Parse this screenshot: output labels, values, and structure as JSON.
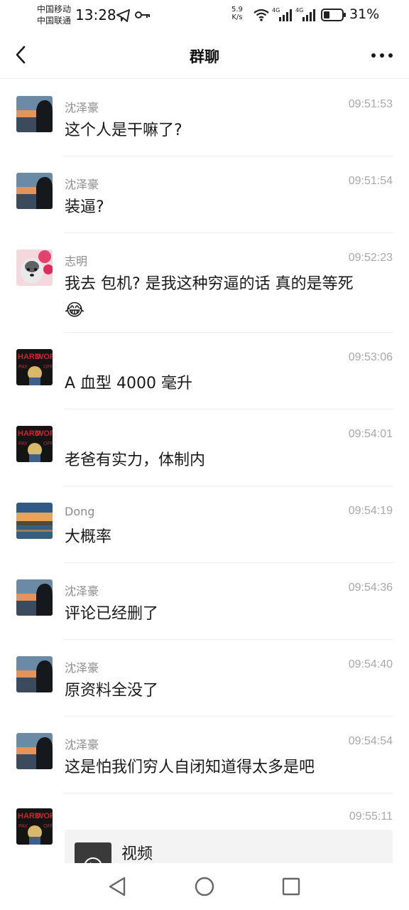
{
  "status_bar": {
    "carrier_1": "中国移动",
    "carrier_2": "中国联通",
    "time": "13:28",
    "speed_value": "5.9",
    "speed_unit": "K/s",
    "net_1": "4G",
    "net_2": "4G",
    "battery_percent": "31%",
    "icons": [
      "telegram-icon",
      "key-icon",
      "wifi-icon",
      "signal-icon",
      "battery-icon"
    ]
  },
  "header": {
    "title": "群聊",
    "back_icon": "chevron-left-icon",
    "more_icon": "more-dots-icon"
  },
  "messages": [
    {
      "sender": "沈泽豪",
      "time": "09:51:53",
      "text": "这个人是干嘛了?",
      "avatar": "silhouette-sunset"
    },
    {
      "sender": "沈泽豪",
      "time": "09:51:54",
      "text": "装逼?",
      "avatar": "silhouette-sunset"
    },
    {
      "sender": "志明",
      "time": "09:52:23",
      "text": "我去 包机? 是我这种穷逼的话 真的是等死",
      "emoji": "😂",
      "avatar": "husky-flowers"
    },
    {
      "sender": "",
      "time": "09:53:06",
      "text": "A 血型 4000 毫升",
      "avatar": "hardwork-poster"
    },
    {
      "sender": "",
      "time": "09:54:01",
      "text": "老爸有实力，体制内",
      "avatar": "hardwork-poster"
    },
    {
      "sender": "Dong",
      "time": "09:54:19",
      "text": "大概率",
      "avatar": "lake-sunset"
    },
    {
      "sender": "沈泽豪",
      "time": "09:54:36",
      "text": "评论已经删了",
      "avatar": "silhouette-sunset"
    },
    {
      "sender": "沈泽豪",
      "time": "09:54:40",
      "text": "原资料全没了",
      "avatar": "silhouette-sunset"
    },
    {
      "sender": "沈泽豪",
      "time": "09:54:54",
      "text": "这是怕我们穷人自闭知道得太多是吧",
      "avatar": "silhouette-sunset"
    },
    {
      "sender": "",
      "time": "09:55:11",
      "video_label": "视频",
      "avatar": "hardwork-poster"
    }
  ],
  "bottom_nav": {
    "icons": [
      "back-triangle-icon",
      "home-circle-icon",
      "recents-square-icon"
    ]
  },
  "colors": {
    "background": "#ffffff",
    "meta_text": "#a8a8a8",
    "divider": "#ececec",
    "video_card": "#f3f3f3"
  }
}
